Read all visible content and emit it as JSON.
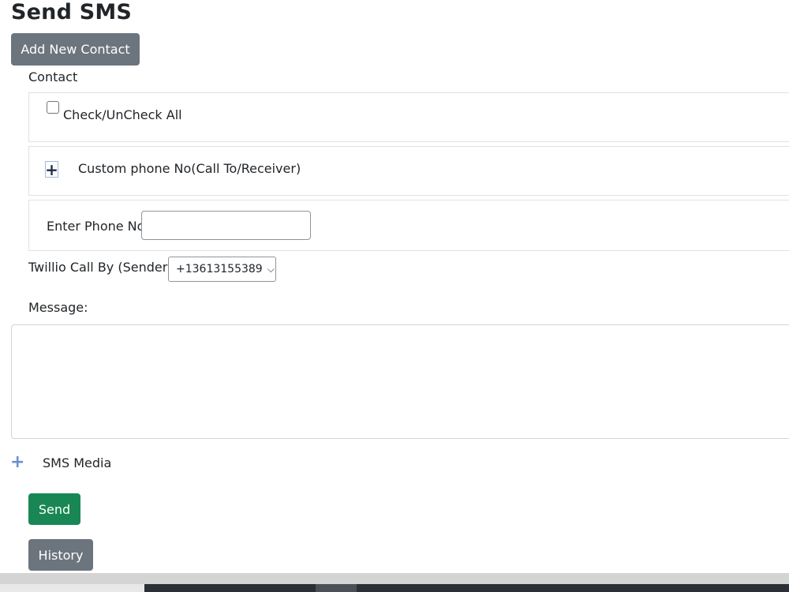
{
  "page": {
    "title": "Send SMS"
  },
  "buttons": {
    "add_contact": "Add New Contact",
    "send": "Send",
    "history": "History"
  },
  "contact": {
    "label": "Contact",
    "check_all_label": "Check/UnCheck All",
    "check_all_checked": false,
    "custom_phone_label": "Custom phone No(Call To/Receiver)",
    "custom_toggle_icon": "plus-icon",
    "enter_phone_label": "Enter Phone No",
    "phone_value": ""
  },
  "sender": {
    "label": "Twillio Call By (Sender)",
    "selected": "+13613155389"
  },
  "message": {
    "label": "Message:",
    "value": ""
  },
  "media": {
    "label": "SMS Media",
    "icon": "plus-icon"
  },
  "colors": {
    "primary_gray": "#6c757d",
    "success_green": "#198754",
    "media_plus": "#6f8fd0"
  }
}
